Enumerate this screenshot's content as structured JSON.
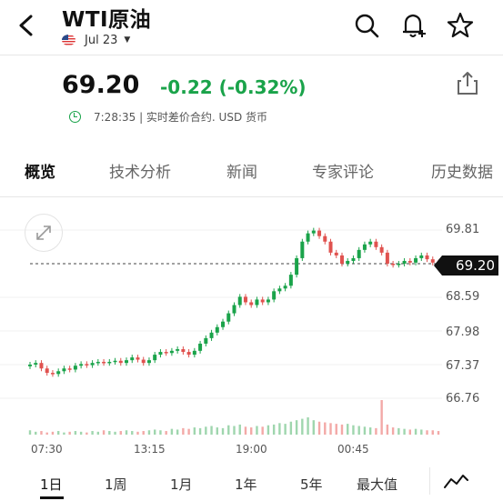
{
  "header": {
    "title": "WTI原油",
    "date": "Jul 23"
  },
  "quote": {
    "price": "69.20",
    "change": "-0.22 (-0.32%)",
    "time_info": "7:28:35 | 实时差价合约. USD 货币"
  },
  "tabs": [
    "概览",
    "技术分析",
    "新闻",
    "专家评论",
    "历史数据"
  ],
  "colors": {
    "up": "#1aa34a",
    "down": "#e0524f",
    "volume_up": "#9fd6ae",
    "volume_down": "#f3a9a7"
  },
  "chart_data": {
    "type": "candlestick",
    "current_price": "69.20",
    "y_ticks": [
      "69.81",
      "69.20",
      "68.59",
      "67.98",
      "67.37",
      "66.76"
    ],
    "ylim": [
      66.76,
      69.81
    ],
    "x_ticks": [
      "07:30",
      "13:15",
      "19:00",
      "00:45"
    ],
    "series": [
      {
        "values": [
          67.37,
          67.4,
          67.3,
          67.22,
          67.2,
          67.25,
          67.3,
          67.28,
          67.35,
          67.38,
          67.36,
          67.4,
          67.42,
          67.4,
          67.42,
          67.44,
          67.4,
          67.45,
          67.5,
          67.46,
          67.4,
          67.45,
          67.55,
          67.6,
          67.58,
          67.62,
          67.65,
          67.6,
          67.55,
          67.62,
          67.75,
          67.85,
          67.95,
          68.05,
          68.15,
          68.3,
          68.45,
          68.6,
          68.5,
          68.45,
          68.55,
          68.5,
          68.55,
          68.7,
          68.75,
          68.8,
          69.0,
          69.3,
          69.6,
          69.75,
          69.8,
          69.7,
          69.6,
          69.4,
          69.35,
          69.2,
          69.25,
          69.3,
          69.45,
          69.55,
          69.6,
          69.5,
          69.4,
          69.2,
          69.18,
          69.2,
          69.25,
          69.22,
          69.3,
          69.35,
          69.28,
          69.22,
          69.2
        ]
      }
    ],
    "volume": [
      6,
      4,
      5,
      3,
      4,
      5,
      3,
      4,
      5,
      4,
      3,
      5,
      4,
      6,
      5,
      4,
      5,
      6,
      5,
      4,
      5,
      6,
      7,
      6,
      5,
      8,
      7,
      9,
      8,
      10,
      9,
      11,
      12,
      10,
      9,
      13,
      12,
      14,
      11,
      10,
      12,
      11,
      13,
      14,
      16,
      15,
      18,
      20,
      22,
      24,
      20,
      18,
      17,
      16,
      15,
      14,
      15,
      13,
      12,
      11,
      10,
      9,
      48,
      14,
      10,
      9,
      8,
      7,
      8,
      7,
      6,
      6,
      5
    ]
  },
  "ranges": [
    "1日",
    "1周",
    "1月",
    "1年",
    "5年",
    "最大值"
  ],
  "active_range": "1日"
}
